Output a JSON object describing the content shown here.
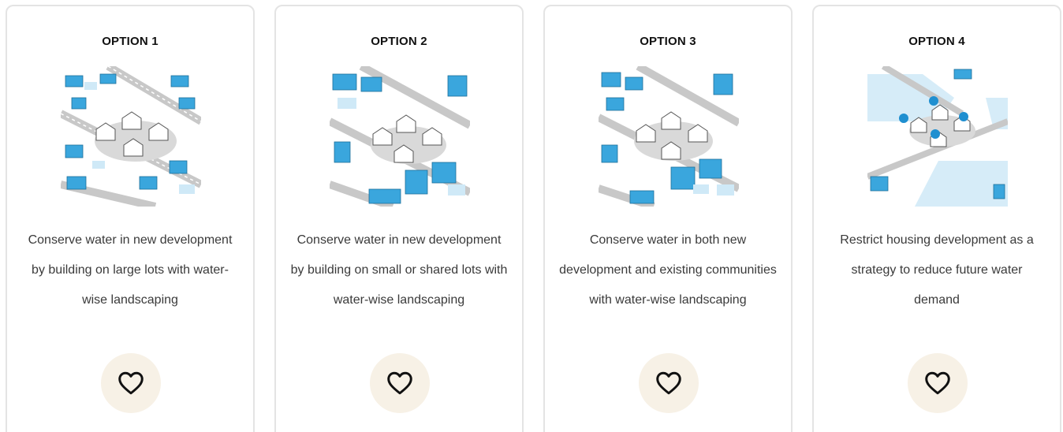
{
  "options": [
    {
      "title": "OPTION 1",
      "image_icon": "suburban-large-lots-illustration",
      "description": "Conserve water in new development by building on large lots with water-wise landscaping",
      "favorite_icon": "heart-icon"
    },
    {
      "title": "OPTION 2",
      "image_icon": "suburban-small-lots-illustration",
      "description": "Conserve water in new development by building on small or shared lots with water-wise landscaping",
      "favorite_icon": "heart-icon"
    },
    {
      "title": "OPTION 3",
      "image_icon": "mixed-communities-illustration",
      "description": "Conserve water in both new development and existing communities with water-wise landscaping",
      "favorite_icon": "heart-icon"
    },
    {
      "title": "OPTION 4",
      "image_icon": "restricted-development-illustration",
      "description": "Restrict housing development as a strategy to reduce future water demand",
      "favorite_icon": "heart-icon"
    }
  ],
  "colors": {
    "accent_blue": "#3aa6dd",
    "light_blue": "#cfe9f7",
    "fav_bg": "#f7f1e6",
    "border": "#e4e4e4"
  }
}
